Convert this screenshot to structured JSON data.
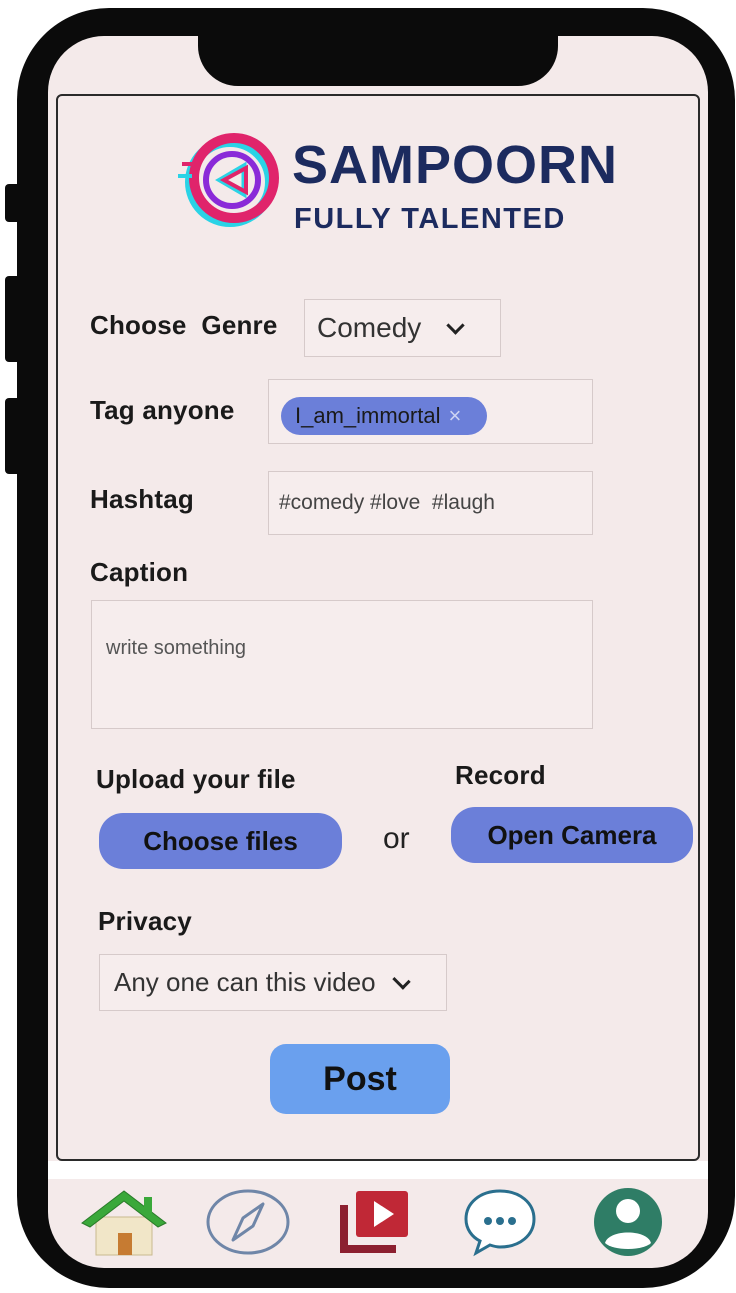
{
  "brand": {
    "name": "SAMPOORN",
    "tagline": "FULLY TALENTED"
  },
  "form": {
    "genre": {
      "label": "Choose  Genre",
      "value": "Comedy"
    },
    "tag": {
      "label": "Tag anyone",
      "chip": "I_am_immortal",
      "remove_glyph": "×"
    },
    "hashtag": {
      "label": "Hashtag",
      "value": "#comedy #love  #laugh"
    },
    "caption": {
      "label": "Caption",
      "placeholder": "write something"
    },
    "upload": {
      "label": "Upload your file",
      "button": "Choose files"
    },
    "separator": "or",
    "record": {
      "label": "Record",
      "button": "Open Camera"
    },
    "privacy": {
      "label": "Privacy",
      "value": "Any one can this video"
    },
    "submit": "Post"
  },
  "nav": {
    "items": [
      {
        "id": "home",
        "icon": "home-icon"
      },
      {
        "id": "explore",
        "icon": "compass-icon"
      },
      {
        "id": "videos",
        "icon": "video-library-icon"
      },
      {
        "id": "messages",
        "icon": "chat-icon"
      },
      {
        "id": "profile",
        "icon": "profile-icon"
      }
    ]
  },
  "colors": {
    "accent": "#6b7fd9",
    "post": "#6aa0ee",
    "screen": "#f4eaea",
    "brand": "#1c2b5f"
  }
}
